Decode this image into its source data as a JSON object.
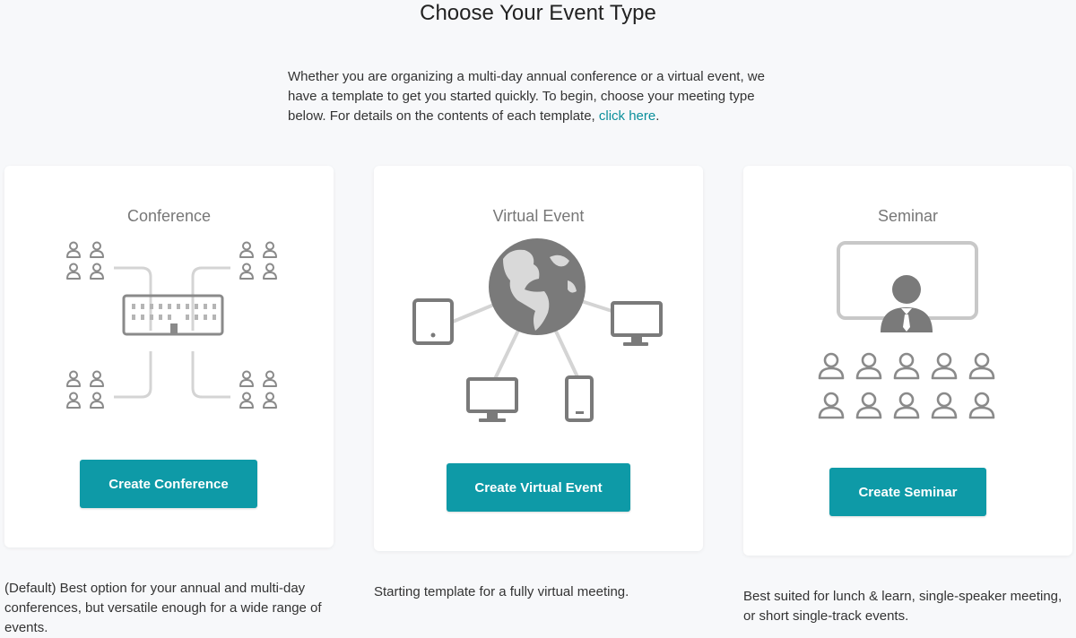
{
  "header": {
    "title": "Choose Your Event Type"
  },
  "intro": {
    "text": "Whether you are organizing a multi-day annual conference or a virtual event, we have a template to get you started quickly. To begin, choose your meeting type below. For details on the contents of each template, ",
    "link_label": "click here",
    "suffix": "."
  },
  "cards": {
    "conference": {
      "title": "Conference",
      "button_label": "Create Conference",
      "description": "(Default) Best option for your annual and multi-day conferences, but versatile enough for a wide range of events.",
      "icon": "conference-network-icon"
    },
    "virtual": {
      "title": "Virtual Event",
      "button_label": "Create Virtual Event",
      "description": "Starting template for a fully virtual meeting.",
      "icon": "globe-devices-icon"
    },
    "seminar": {
      "title": "Seminar",
      "button_label": "Create Seminar",
      "description": "Best suited for lunch & learn, single-speaker meeting, or short single-track events.",
      "icon": "presenter-audience-icon"
    }
  },
  "colors": {
    "accent": "#0e9aa7",
    "link": "#0a8f9b",
    "icon_dark": "#7a7a7a",
    "icon_light": "#d4d4d4",
    "background": "#f7f8fa"
  }
}
